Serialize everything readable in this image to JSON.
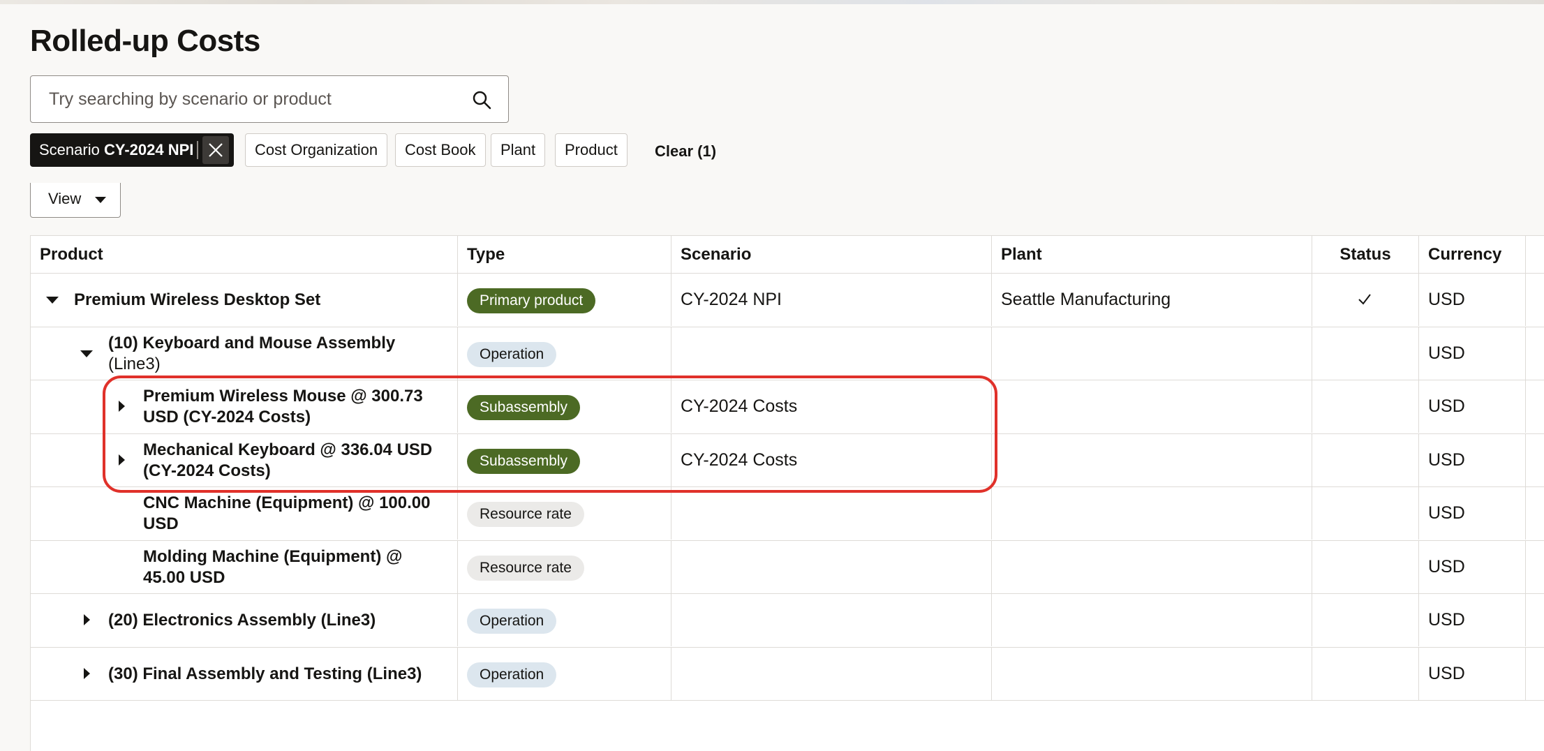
{
  "page": {
    "title": "Rolled-up Costs"
  },
  "search": {
    "placeholder": "Try searching by scenario or product"
  },
  "filters": {
    "active": {
      "label": "Scenario",
      "value": "CY-2024 NPI"
    },
    "chips": [
      "Cost Organization",
      "Cost Book",
      "Plant",
      "Product"
    ],
    "clear_label": "Clear (1)"
  },
  "view_button": {
    "label": "View"
  },
  "table": {
    "headers": {
      "product": "Product",
      "type": "Type",
      "scenario": "Scenario",
      "plant": "Plant",
      "status": "Status",
      "currency": "Currency"
    },
    "rows": [
      {
        "product_line1": "Premium Wireless Desktop Set",
        "product_line2": "",
        "type": "Primary product",
        "scenario": "CY-2024 NPI",
        "plant": "Seattle Manufacturing",
        "status": "check-icon",
        "currency": "USD"
      },
      {
        "product_line1": "(10) Keyboard and Mouse Assembly",
        "product_line2": "(Line3)",
        "type": "Operation",
        "scenario": "",
        "plant": "",
        "currency": "USD"
      },
      {
        "product_line1": "Premium Wireless Mouse @ 300.73",
        "product_line2": "USD (CY-2024 Costs)",
        "type": "Subassembly",
        "scenario": "CY-2024 Costs",
        "plant": "",
        "currency": "USD"
      },
      {
        "product_line1": "Mechanical Keyboard @ 336.04 USD",
        "product_line2": "(CY-2024 Costs)",
        "type": "Subassembly",
        "scenario": "CY-2024 Costs",
        "plant": "",
        "currency": "USD"
      },
      {
        "product_line1": "CNC Machine (Equipment) @ 100.00",
        "product_line2": "USD",
        "type": "Resource rate",
        "scenario": "",
        "plant": "",
        "currency": "USD"
      },
      {
        "product_line1": "Molding Machine (Equipment) @",
        "product_line2": "45.00 USD",
        "type": "Resource rate",
        "scenario": "",
        "plant": "",
        "currency": "USD"
      },
      {
        "product_line1": "(20) Electronics Assembly (Line3)",
        "product_line2": "",
        "type": "Operation",
        "scenario": "",
        "plant": "",
        "currency": "USD"
      },
      {
        "product_line1": "(30) Final Assembly and Testing (Line3)",
        "product_line2": "",
        "type": "Operation",
        "scenario": "",
        "plant": "",
        "currency": "USD"
      }
    ]
  },
  "colors": {
    "accent_green": "#4c6a24",
    "operation_blue": "#dce6ee",
    "resource_gray": "#ebeae8",
    "highlight_red": "#e0312a"
  }
}
